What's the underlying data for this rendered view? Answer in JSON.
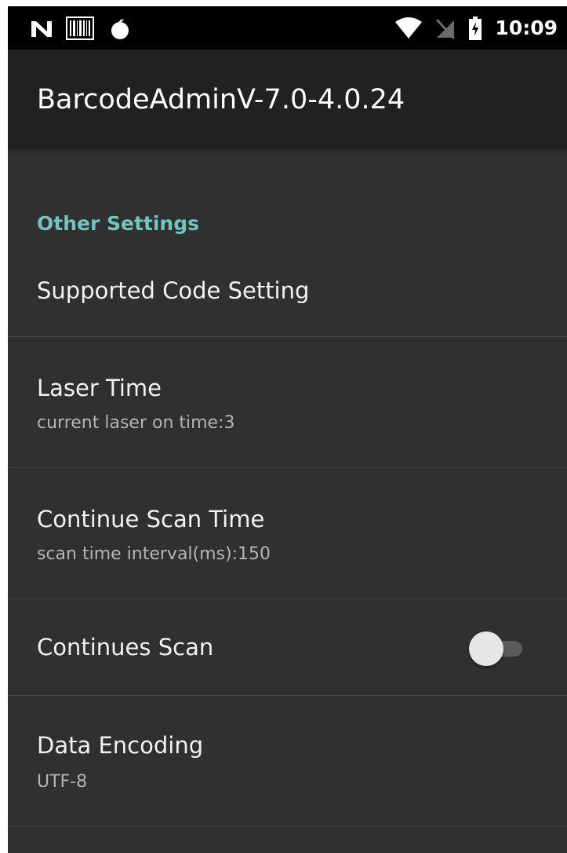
{
  "status_bar": {
    "time": "10:09",
    "left_icons": [
      "nfc-n-icon",
      "barcode-icon",
      "flame-icon"
    ],
    "right_icons": [
      "wifi-icon",
      "no-sim-icon",
      "battery-charging-icon"
    ]
  },
  "app_bar": {
    "title": "BarcodeAdminV-7.0-4.0.24"
  },
  "section": {
    "header": "Other Settings"
  },
  "preferences": {
    "supported_code": {
      "title": "Supported Code Setting"
    },
    "laser_time": {
      "title": "Laser Time",
      "summary": "current laser on time:3"
    },
    "continue_scan_time": {
      "title": "Continue Scan Time",
      "summary": "scan time interval(ms):150"
    },
    "continues_scan": {
      "title": "Continues Scan",
      "enabled": false
    },
    "data_encoding": {
      "title": "Data Encoding",
      "summary": "UTF-8"
    }
  },
  "colors": {
    "accent": "#6fc6bd",
    "background": "#303030",
    "app_bar": "#212121",
    "status_bar": "#000000"
  }
}
